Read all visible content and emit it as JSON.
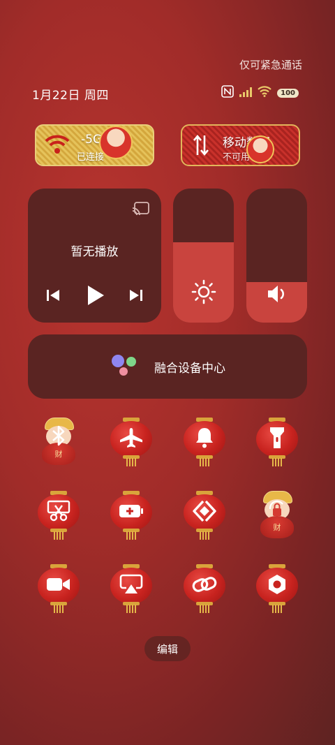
{
  "status": {
    "emergency_text": "仅可紧急通话",
    "date": "1月22日 周四",
    "battery": "100",
    "icons": [
      "nfc-icon",
      "signal-icon",
      "wifi-icon",
      "battery-icon"
    ]
  },
  "tiles": {
    "wifi": {
      "title": "-5G MI",
      "subtitle": "已连接",
      "icon": "wifi-icon"
    },
    "mobile": {
      "title": "移动数据",
      "subtitle": "不可用",
      "icon": "data-arrows-icon"
    }
  },
  "media": {
    "title": "暂无播放"
  },
  "sliders": {
    "brightness": 0.6,
    "volume": 0.3
  },
  "device_center": {
    "label": "融合设备中心"
  },
  "toggles": [
    {
      "name": "bluetooth",
      "icon": "bluetooth-icon",
      "style": "mascot"
    },
    {
      "name": "airplane",
      "icon": "airplane-icon",
      "style": "lantern"
    },
    {
      "name": "silent",
      "icon": "bell-icon",
      "style": "lantern"
    },
    {
      "name": "flashlight",
      "icon": "flashlight-icon",
      "style": "lantern"
    },
    {
      "name": "screenshot",
      "icon": "scissors-icon",
      "style": "lantern"
    },
    {
      "name": "battery-saver",
      "icon": "battery-plus-icon",
      "style": "lantern"
    },
    {
      "name": "cast",
      "icon": "code-brackets-icon",
      "style": "lantern"
    },
    {
      "name": "lock-rotation",
      "icon": "lock-rotate-icon",
      "style": "mascot"
    },
    {
      "name": "screen-record",
      "icon": "video-camera-icon",
      "style": "lantern"
    },
    {
      "name": "screen-mirror",
      "icon": "airplay-icon",
      "style": "lantern"
    },
    {
      "name": "link",
      "icon": "link-icon",
      "style": "lantern"
    },
    {
      "name": "settings",
      "icon": "hex-nut-icon",
      "style": "lantern"
    }
  ],
  "edit_label": "编辑",
  "colors": {
    "panel": "#5a2422",
    "accent": "#c9443e",
    "gold": "#e9cf7a"
  }
}
